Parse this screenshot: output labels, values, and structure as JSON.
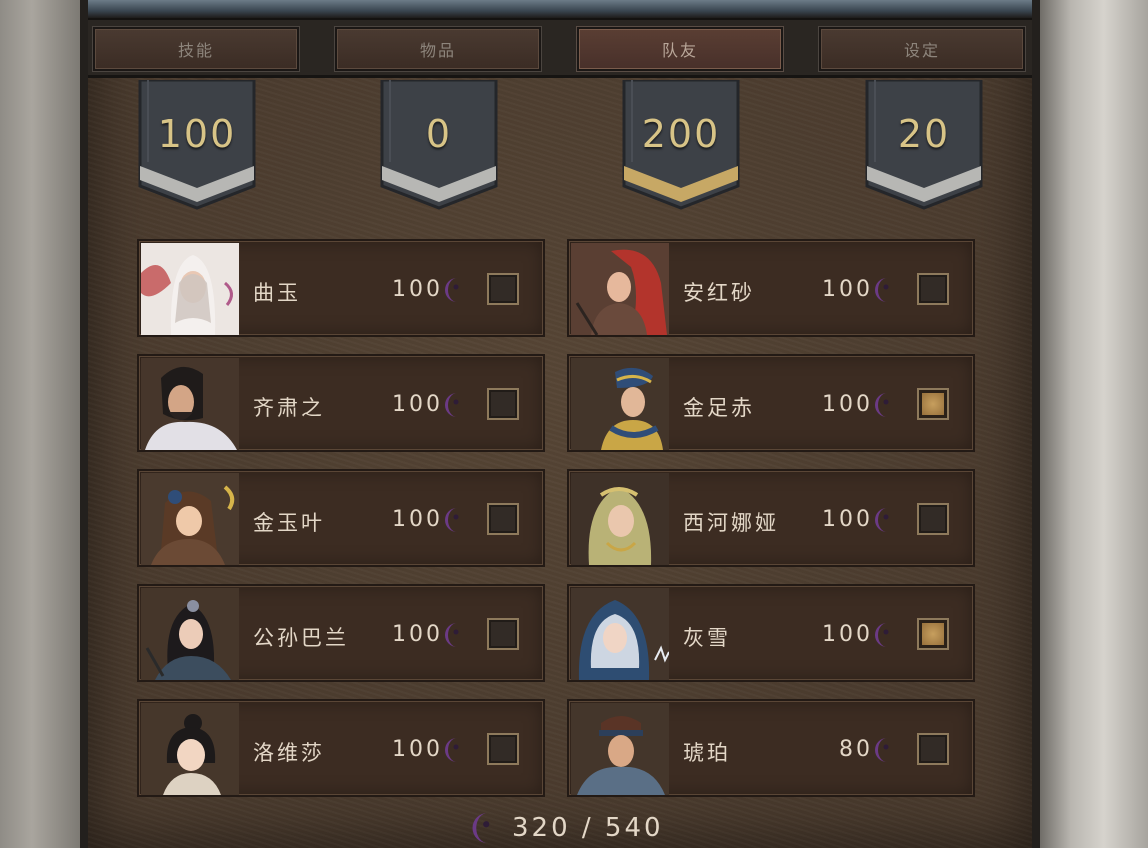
{
  "tabs": [
    {
      "label": "技能",
      "active": false
    },
    {
      "label": "物品",
      "active": false
    },
    {
      "label": "队友",
      "active": true
    },
    {
      "label": "设定",
      "active": false
    }
  ],
  "banners": [
    {
      "value": "100",
      "trim": "silver"
    },
    {
      "value": "0",
      "trim": "silver"
    },
    {
      "value": "200",
      "trim": "gold"
    },
    {
      "value": "20",
      "trim": "silver"
    }
  ],
  "companions": [
    {
      "name": "曲玉",
      "cost": "100",
      "checked": false
    },
    {
      "name": "安红砂",
      "cost": "100",
      "checked": false
    },
    {
      "name": "齐肃之",
      "cost": "100",
      "checked": false
    },
    {
      "name": "金足赤",
      "cost": "100",
      "checked": true
    },
    {
      "name": "金玉叶",
      "cost": "100",
      "checked": false
    },
    {
      "name": "西河娜娅",
      "cost": "100",
      "checked": false
    },
    {
      "name": "公孙巴兰",
      "cost": "100",
      "checked": false
    },
    {
      "name": "灰雪",
      "cost": "100",
      "checked": true
    },
    {
      "name": "洛维莎",
      "cost": "100",
      "checked": false
    },
    {
      "name": "琥珀",
      "cost": "80",
      "checked": false
    }
  ],
  "footer": {
    "points": "320 / 540"
  },
  "icons": {
    "currency": "crescent-moon-icon",
    "currency_color": "#6b3a86"
  },
  "colors": {
    "banner_text": "#d8c487",
    "card_text": "#e3d7c7",
    "gold_trim": "#c7a865"
  }
}
